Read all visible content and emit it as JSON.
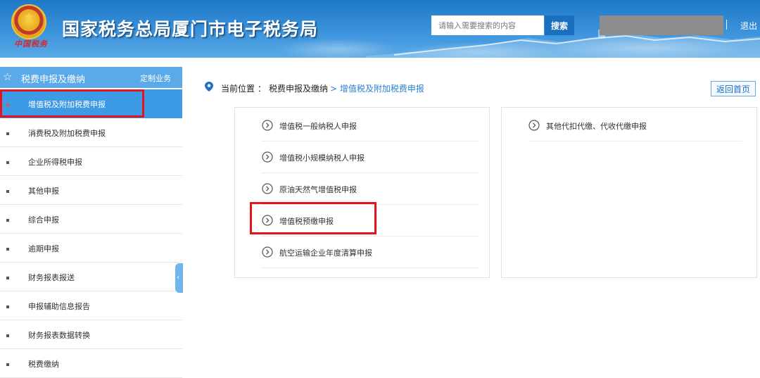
{
  "header": {
    "title": "国家税务总局厦门市电子税务局",
    "emblem_script": "中国税务",
    "search_placeholder": "请输入需要搜索的内容",
    "search_button": "搜索",
    "logout": "退出"
  },
  "sidebar": {
    "heading": "税费申报及缴纳",
    "custom_link": "定制业务",
    "items": [
      {
        "label": "增值税及附加税费申报",
        "active": true
      },
      {
        "label": "消费税及附加税费申报",
        "active": false
      },
      {
        "label": "企业所得税申报",
        "active": false
      },
      {
        "label": "其他申报",
        "active": false
      },
      {
        "label": "综合申报",
        "active": false
      },
      {
        "label": "逾期申报",
        "active": false
      },
      {
        "label": "财务报表报送",
        "active": false
      },
      {
        "label": "申报辅助信息报告",
        "active": false
      },
      {
        "label": "财务报表数据转换",
        "active": false
      },
      {
        "label": "税费缴纳",
        "active": false
      }
    ]
  },
  "breadcrumb": {
    "prefix": "当前位置 ：",
    "level1": "税费申报及缴纳",
    "level2": "> 增值税及附加税费申报"
  },
  "back_home": "返回首页",
  "reports_left": [
    "增值税一般纳税人申报",
    "增值税小规模纳税人申报",
    "原油天然气增值税申报",
    "增值税预缴申报",
    "航空运输企业年度清算申报"
  ],
  "reports_right": [
    "其他代扣代缴、代收代缴申报"
  ],
  "colors": {
    "header_blue": "#1f78c7",
    "sidebar_active": "#3d9ae5",
    "highlight_red": "#e8121b",
    "link_blue": "#2a7fd4"
  }
}
